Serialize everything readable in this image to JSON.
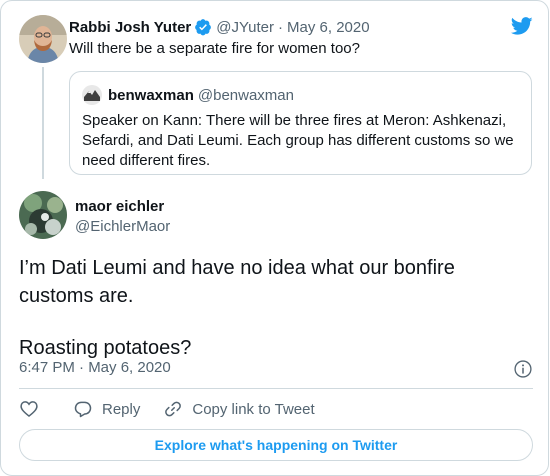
{
  "colors": {
    "brand_blue": "#1d9bf0",
    "text_primary": "#0f1419",
    "text_secondary": "#536471",
    "border": "#cfd9de"
  },
  "reply_tweet": {
    "author_name": "Rabbi Josh Yuter",
    "handle": "@JYuter",
    "separator": "·",
    "date": "May 6, 2020",
    "text": "Will there be a separate fire for women too?",
    "verified_icon": "verified-badge-icon",
    "quoted": {
      "author_name": "benwaxman",
      "handle": "@benwaxman",
      "text": "Speaker on Kann: There will be three fires at Meron: Ashkenazi, Sefardi, and Dati Leumi. Each group has different customs so we need different fires."
    }
  },
  "main_tweet": {
    "author_name": "maor eichler",
    "handle": "@EichlerMaor",
    "paragraphs": [
      "I’m Dati Leumi and have no idea what our bonfire customs are.",
      "Roasting potatoes?"
    ],
    "timestamp": "6:47 PM · May 6, 2020"
  },
  "actions": {
    "like_icon": "heart-icon",
    "reply_label": "Reply",
    "copy_link_label": "Copy link to Tweet"
  },
  "explore_label": "Explore what's happening on Twitter"
}
